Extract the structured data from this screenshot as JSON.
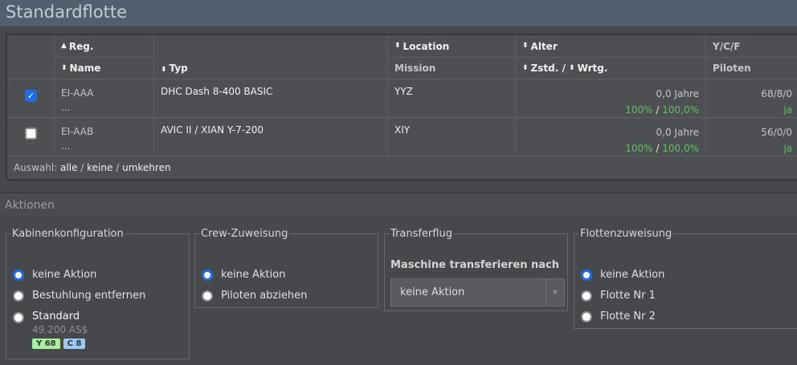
{
  "title": "Standardflotte",
  "table": {
    "headers": {
      "reg": "Reg.",
      "name": "Name",
      "typ": "Typ",
      "location": "Location",
      "mission": "Mission",
      "alter": "Alter",
      "zstd": "Zstd.",
      "sep": "/",
      "wrtg": "Wrtg.",
      "ycf": "Y/C/F",
      "piloten": "Piloten"
    },
    "rows": [
      {
        "checked": true,
        "reg": "EI-AAA",
        "name": "...",
        "typ": "DHC Dash 8-400 BASIC",
        "location": "YYZ",
        "alter": "0,0 Jahre",
        "zstd": "100%",
        "wrtg": "100,0%",
        "ycf": "68/8/0",
        "piloten": "ja"
      },
      {
        "checked": false,
        "reg": "EI-AAB",
        "name": "...",
        "typ": "AVIC II / XIAN Y-7-200",
        "location": "XIY",
        "alter": "0,0 Jahre",
        "zstd": "100%",
        "wrtg": "100,0%",
        "ycf": "56/0/0",
        "piloten": "ja"
      }
    ],
    "footer": {
      "label": "Auswahl:",
      "all": "alle",
      "none": "keine",
      "invert": "umkehren",
      "sep": "/"
    }
  },
  "actions": {
    "title": "Aktionen",
    "kabinen": {
      "legend": "Kabinenkonfiguration",
      "options": [
        "keine Aktion",
        "Bestuhlung entfernen",
        "Standard"
      ],
      "price": "49.200 AS$",
      "badge_y": "Y 68",
      "badge_c": "C 8",
      "selected": 0
    },
    "crew": {
      "legend": "Crew-Zuweisung",
      "options": [
        "keine Aktion",
        "Piloten abziehen"
      ],
      "selected": 0
    },
    "transfer": {
      "legend": "Transferflug",
      "label": "Maschine transferieren nach",
      "select_value": "keine Aktion"
    },
    "flotte": {
      "legend": "Flottenzuweisung",
      "options": [
        "keine Aktion",
        "Flotte Nr 1",
        "Flotte Nr 2"
      ],
      "selected": 0
    }
  },
  "colors": {
    "accent": "#1a6fe8",
    "green": "#5cc25c",
    "badge_y": "#a8f0a0",
    "badge_c": "#9cc8f8"
  }
}
